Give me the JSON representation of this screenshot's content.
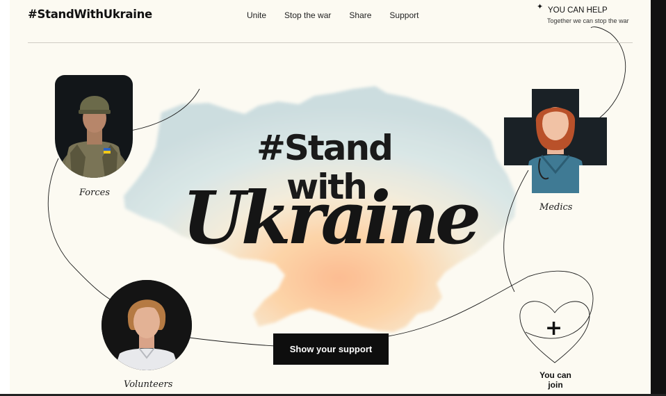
{
  "header": {
    "brand": "#StandWithUkraine",
    "nav": [
      {
        "label": "Unite"
      },
      {
        "label": "Stop the war"
      },
      {
        "label": "Share"
      },
      {
        "label": "Support"
      }
    ],
    "help": {
      "icon": "sparkle-icon",
      "title": "YOU CAN HELP",
      "subtitle": "Together we can stop the war"
    }
  },
  "hero": {
    "line1": "#Stand",
    "line2": "with",
    "line3": "Ukraine",
    "cta": "Show your support"
  },
  "cards": {
    "forces": {
      "caption": "Forces",
      "image": "soldier-portrait"
    },
    "medics": {
      "caption": "Medics",
      "image": "medic-portrait"
    },
    "volunteers": {
      "caption": "Volunteers",
      "image": "volunteer-portrait"
    }
  },
  "join": {
    "icon": "plus-icon",
    "plus": "+",
    "label": "You can\njoin"
  },
  "colors": {
    "background": "#fcfaf2",
    "text": "#141414",
    "map_blue": "#cfdfe3",
    "map_yellow": "#ffd99a",
    "map_orange": "#f9b894",
    "button": "#0e0e0e"
  }
}
